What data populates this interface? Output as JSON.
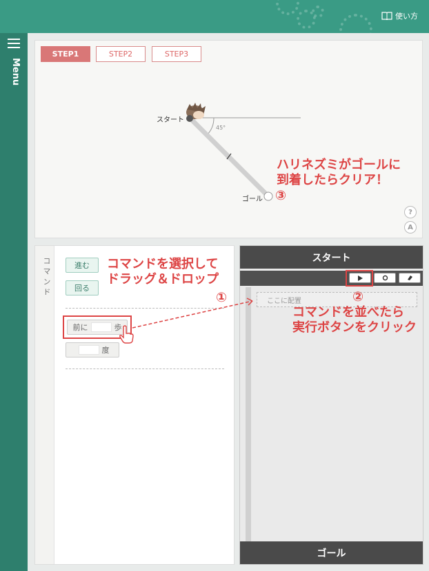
{
  "header": {
    "help_label": "使い方"
  },
  "sidebar": {
    "menu_label": "Menu"
  },
  "stage": {
    "steps": [
      "STEP1",
      "STEP2",
      "STEP3"
    ],
    "active_step": "STEP1",
    "start_label": "スタート",
    "goal_label": "ゴール",
    "angle_label": "45°",
    "annotation_goal": [
      "ハリネズミがゴールに",
      "到着したらクリア！"
    ],
    "annotation_num": "③",
    "help_button": "?",
    "answer_button": "A"
  },
  "commands": {
    "side_label": "コマンド",
    "move_label": "進む",
    "turn_label": "回る",
    "forward_prefix": "前に",
    "forward_unit": "歩",
    "degree_unit": "度",
    "annotation_drag": [
      "コマンドを選択して",
      "ドラッグ＆ドロップ"
    ],
    "annotation_num": "①"
  },
  "program": {
    "start_label": "スタート",
    "goal_label": "ゴール",
    "slot_placeholder": "ここに配置",
    "annotation_run": [
      "コマンドを並べたら",
      "実行ボタンをクリック"
    ],
    "annotation_num": "②"
  },
  "colors": {
    "header": "#3a9b85",
    "sidebar": "#2e7f6d",
    "accent_red": "#d44444",
    "step_active": "#d97777"
  }
}
